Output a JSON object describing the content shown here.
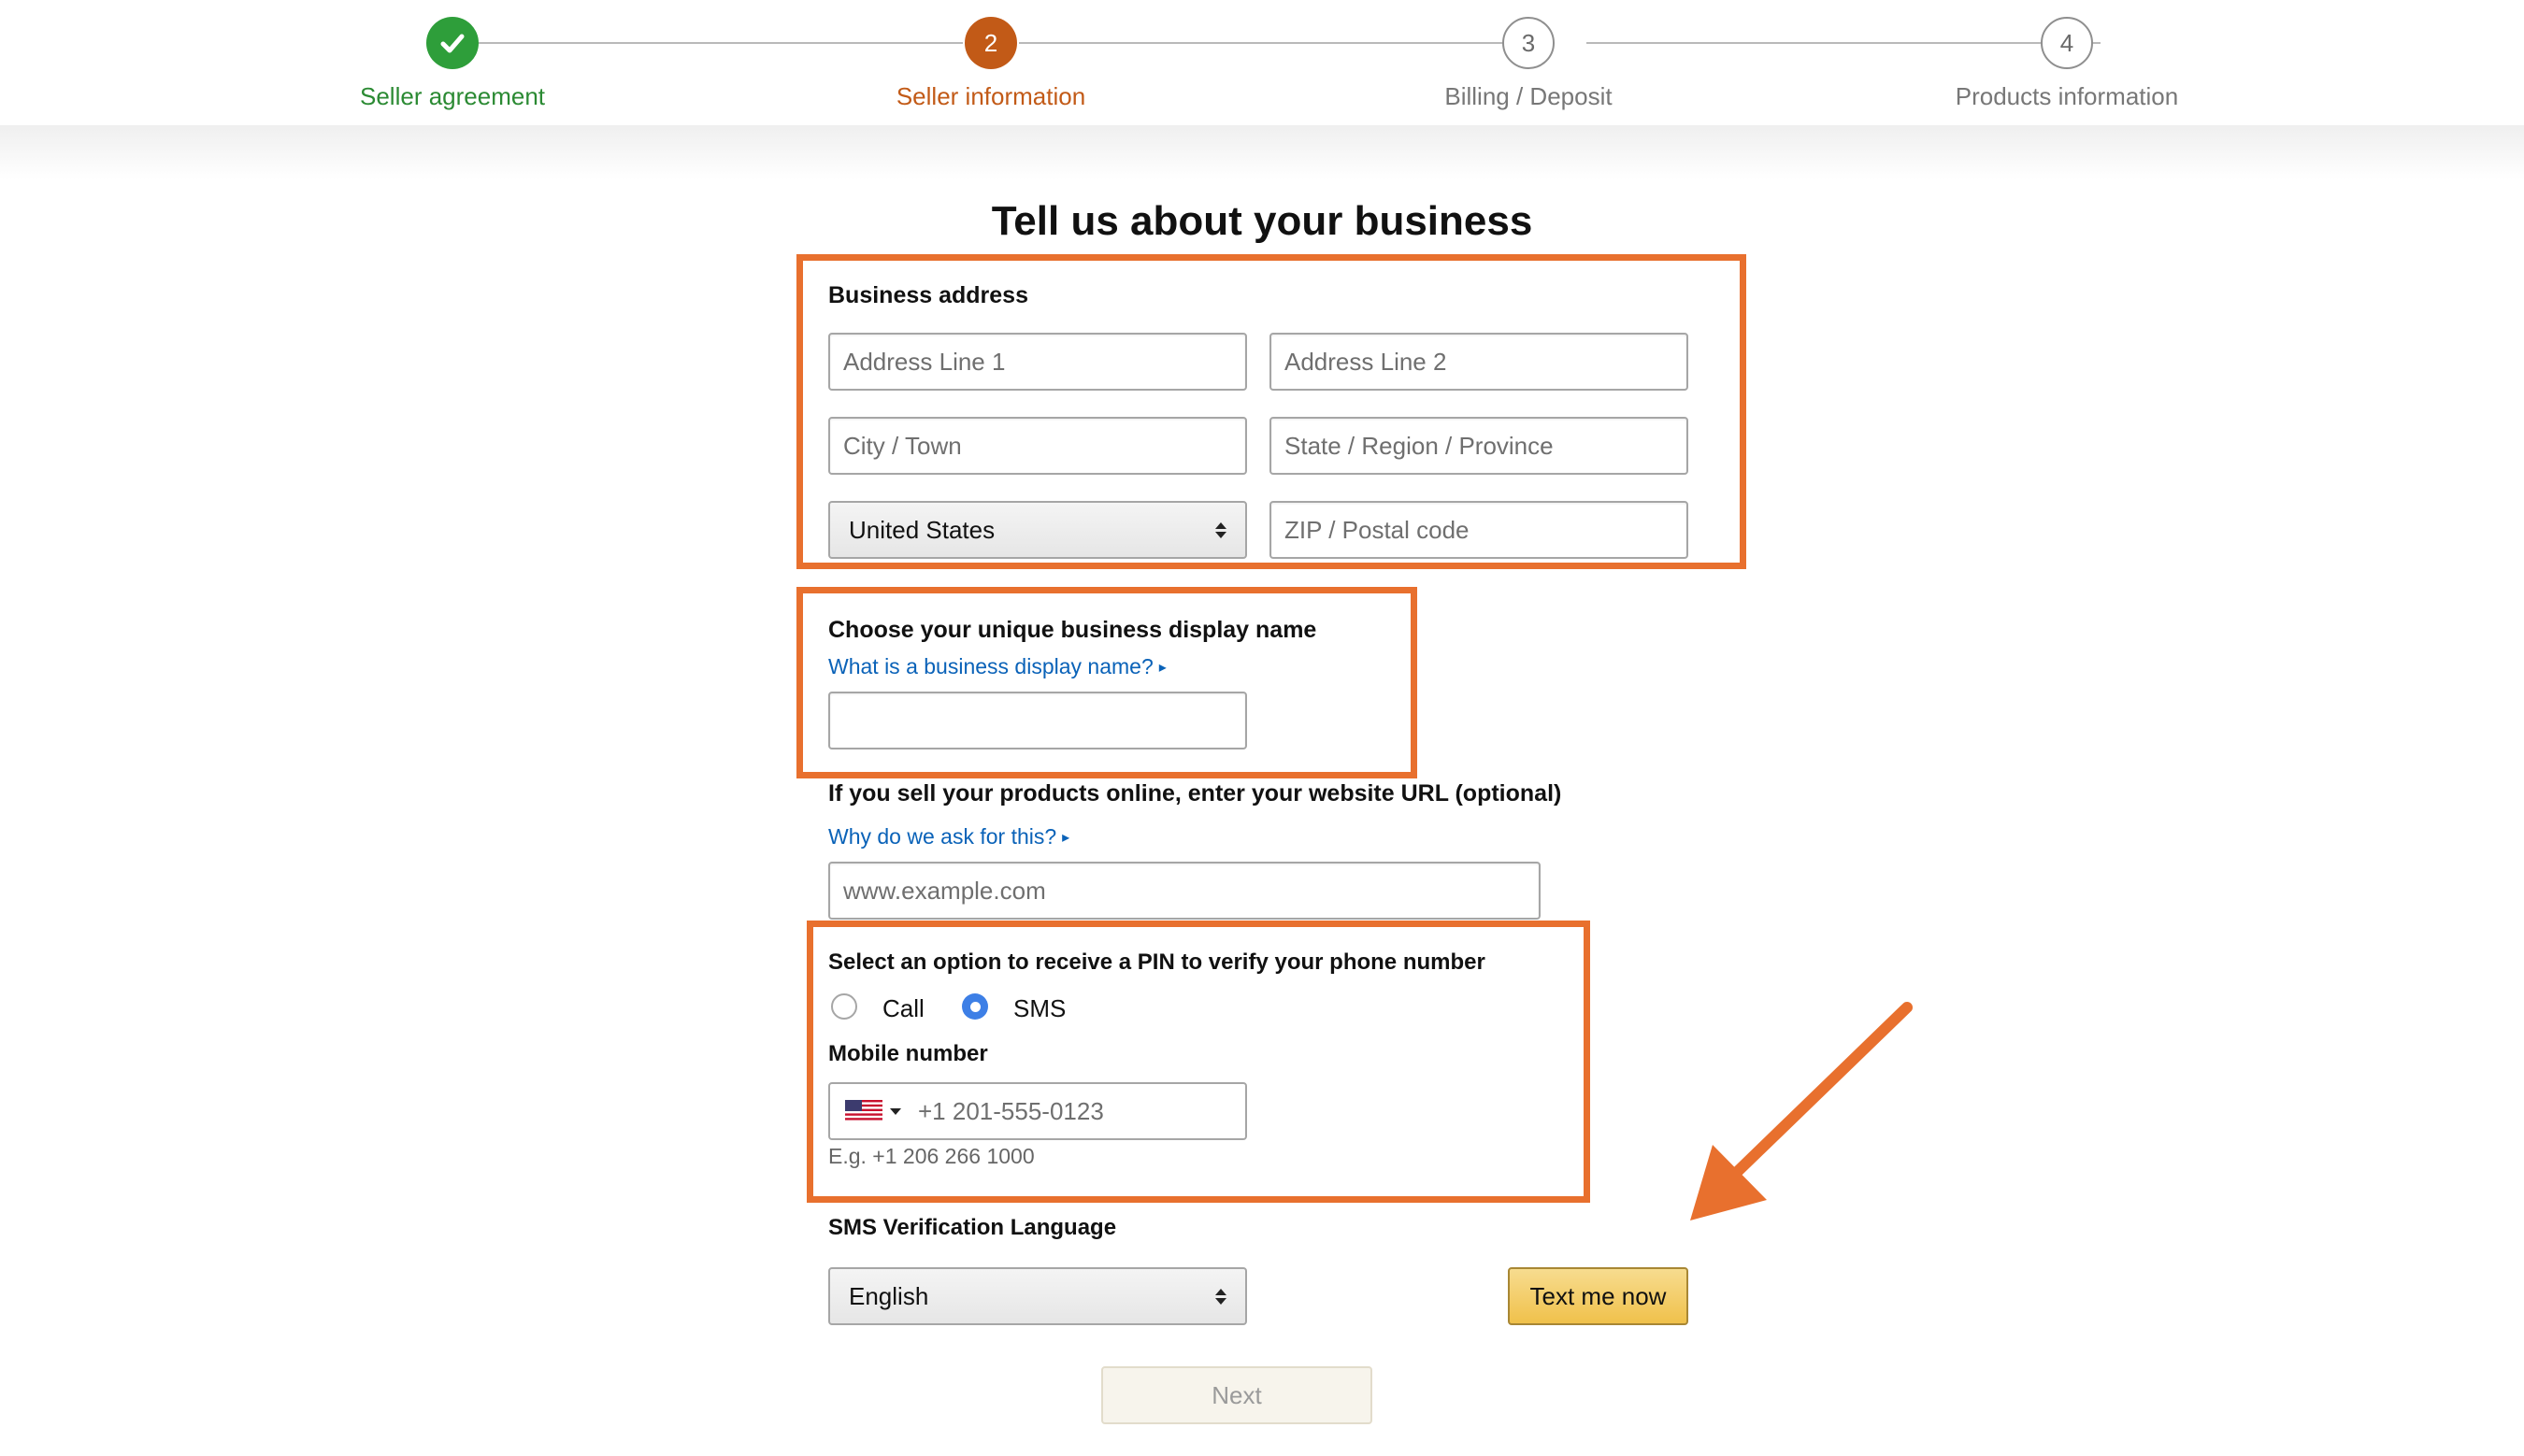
{
  "stepper": {
    "steps": [
      {
        "number": "",
        "label": "Seller agreement",
        "state": "done"
      },
      {
        "number": "2",
        "label": "Seller information",
        "state": "current"
      },
      {
        "number": "3",
        "label": "Billing / Deposit",
        "state": "todo"
      },
      {
        "number": "4",
        "label": "Products information",
        "state": "todo"
      }
    ]
  },
  "page": {
    "title": "Tell us about your business"
  },
  "business_address": {
    "heading": "Business address",
    "address_line1_placeholder": "Address Line 1",
    "address_line2_placeholder": "Address Line 2",
    "city_placeholder": "City / Town",
    "state_placeholder": "State / Region / Province",
    "country_selected": "United States",
    "zip_placeholder": "ZIP / Postal code"
  },
  "display_name": {
    "heading": "Choose your unique business display name",
    "help_link": "What is a business display name?",
    "value": ""
  },
  "website": {
    "heading": "If you sell your products online, enter your website URL (optional)",
    "help_link": "Why do we ask for this?",
    "placeholder": "www.example.com"
  },
  "phone_verification": {
    "heading": "Select an option to receive a PIN to verify your phone number",
    "options": [
      {
        "label": "Call",
        "selected": false
      },
      {
        "label": "SMS",
        "selected": true
      }
    ],
    "mobile_label": "Mobile number",
    "mobile_placeholder": "+1 201-555-0123",
    "country_flag": "us-flag-icon",
    "example": "E.g. +1 206 266 1000"
  },
  "sms_language": {
    "heading": "SMS Verification Language",
    "selected": "English"
  },
  "actions": {
    "text_me_now": "Text me now",
    "next": "Next"
  },
  "colors": {
    "highlight": "#e8702e",
    "step_done": "#2e9e3a",
    "step_current": "#c25a17",
    "link": "#0a62b8",
    "primary_button": "#f0c14b"
  }
}
